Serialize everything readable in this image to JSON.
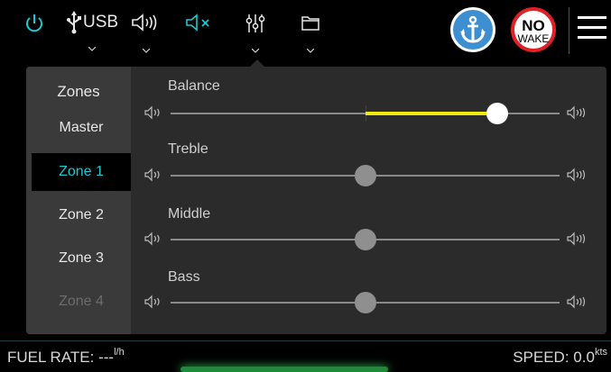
{
  "topbar": {
    "usb_label": "USB",
    "nowake_line1": "NO",
    "nowake_line2": "WAKE"
  },
  "zones": {
    "title": "Zones",
    "items": [
      {
        "label": "Master",
        "state": "normal"
      },
      {
        "label": "Zone 1",
        "state": "active"
      },
      {
        "label": "Zone 2",
        "state": "normal"
      },
      {
        "label": "Zone 3",
        "state": "normal"
      },
      {
        "label": "Zone 4",
        "state": "disabled"
      }
    ]
  },
  "sliders": [
    {
      "label": "Balance",
      "value": 0.84,
      "type": "balance"
    },
    {
      "label": "Treble",
      "value": 0.5,
      "type": "level"
    },
    {
      "label": "Middle",
      "value": 0.5,
      "type": "level"
    },
    {
      "label": "Bass",
      "value": 0.5,
      "type": "level"
    }
  ],
  "status": {
    "fuel_label": "FUEL RATE:",
    "fuel_value": "---",
    "fuel_unit": "l/h",
    "speed_label": "SPEED:",
    "speed_value": "0.0",
    "speed_unit": "kts"
  },
  "colors": {
    "accent": "#19c9d6",
    "balance_fill": "#f2e80a",
    "anchor_badge": "#3d8fd1",
    "nowake_ring": "#e01f26"
  },
  "icons": [
    "power-icon",
    "usb-icon",
    "volume-icon",
    "mute-icon",
    "equalizer-icon",
    "folder-icon",
    "anchor-icon",
    "menu-icon",
    "speaker-icon"
  ]
}
